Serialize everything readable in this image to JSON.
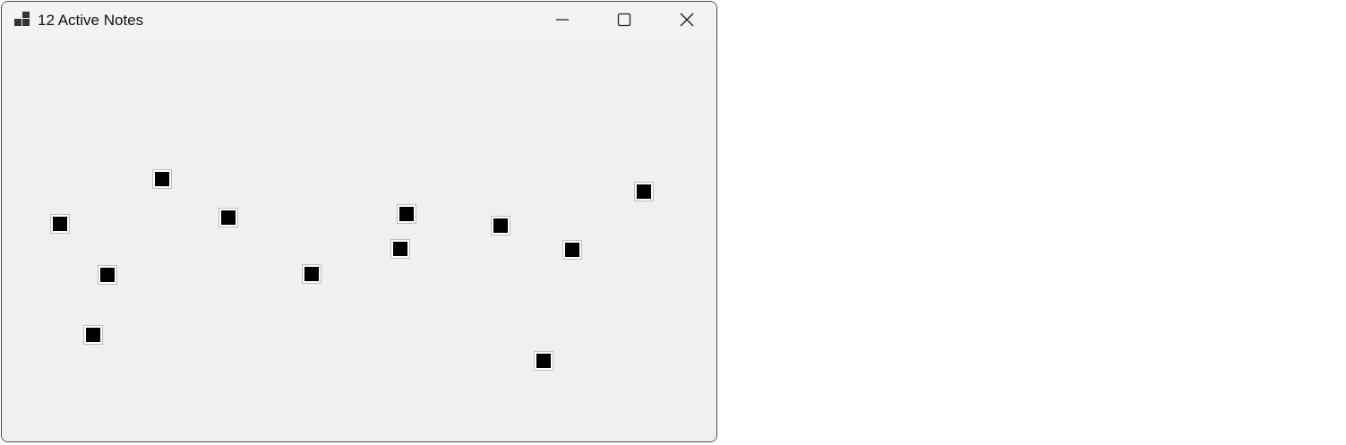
{
  "window": {
    "title": "12 Active Notes"
  },
  "titlebar": {
    "icon": "app-tiles-icon",
    "buttons": {
      "minimize": "minimize-icon",
      "maximize": "maximize-icon",
      "close": "close-icon"
    }
  },
  "notes": {
    "count": 12,
    "color": "#000000",
    "border_color": "#ffffff"
  }
}
